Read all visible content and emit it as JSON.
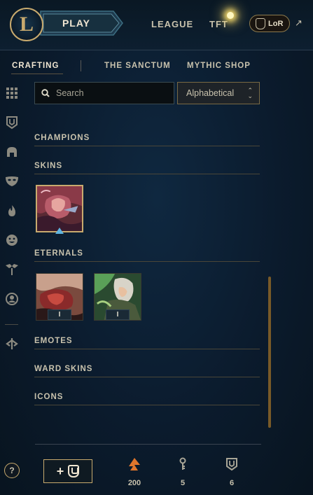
{
  "topbar": {
    "play_label": "PLAY",
    "nav": [
      "LEAGUE",
      "TFT"
    ],
    "lor_label": "LoR",
    "external_icon": "external-arrow-icon"
  },
  "subnav": {
    "tabs": [
      "CRAFTING",
      "THE SANCTUM",
      "MYTHIC SHOP"
    ],
    "active_tab": "CRAFTING"
  },
  "rail": {
    "icons": [
      "grid-icon",
      "loot-shield-icon",
      "champion-helmet-icon",
      "skin-mask-icon",
      "ward-flame-icon",
      "emote-face-icon",
      "eternals-icon",
      "summoner-icon-icon",
      "tft-icon"
    ]
  },
  "search": {
    "placeholder": "Search"
  },
  "sort": {
    "selected": "Alphabetical"
  },
  "sections": {
    "champions": "CHAMPIONS",
    "skins": "SKINS",
    "eternals": "ETERNALS",
    "emotes": "EMOTES",
    "ward_skins": "WARD SKINS",
    "icons": "ICONS"
  },
  "eternals_items": [
    {
      "badge": "I"
    },
    {
      "badge": "I"
    }
  ],
  "footer": {
    "help_label": "?",
    "add_label": "+",
    "currencies": [
      {
        "icon": "orange-essence-icon",
        "value": "200",
        "color": "#e0762c"
      },
      {
        "icon": "key-fragment-icon",
        "value": "5",
        "color": "#a8a596"
      },
      {
        "icon": "chest-icon",
        "value": "6",
        "color": "#a8a596"
      }
    ]
  },
  "colors": {
    "gold": "#c8aa6e",
    "text": "#c8c2ad",
    "accent_blue": "#5fb4e0"
  }
}
